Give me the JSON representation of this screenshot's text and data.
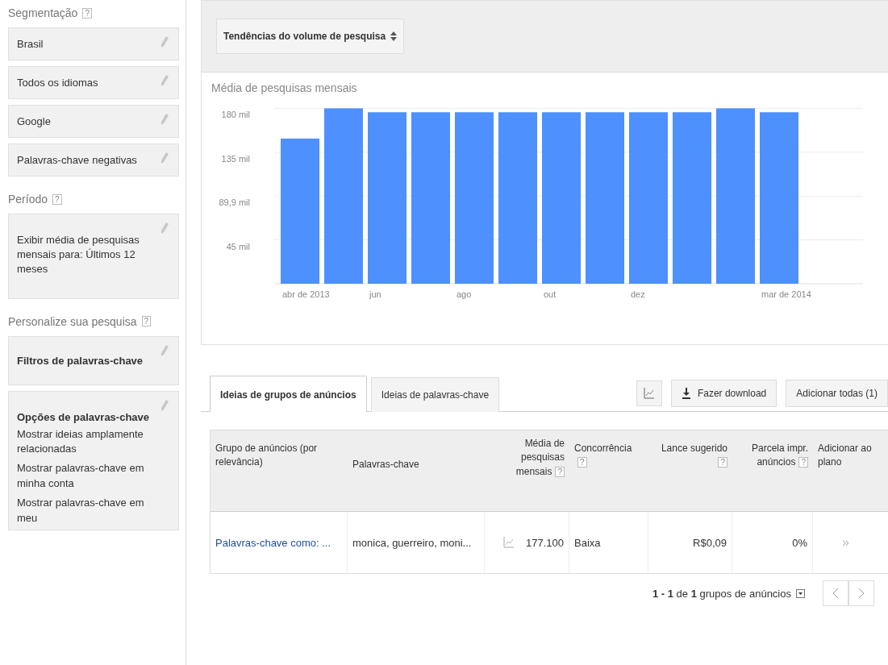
{
  "sidebar": {
    "sections": [
      {
        "title": "Segmentação",
        "help": "?",
        "cards": [
          {
            "kind": "simple",
            "text": "Brasil"
          },
          {
            "kind": "simple",
            "text": "Todos os idiomas"
          },
          {
            "kind": "simple",
            "text": "Google"
          },
          {
            "kind": "simple",
            "text": "Palavras-chave negativas"
          }
        ]
      },
      {
        "title": "Período",
        "help": "?",
        "cards": [
          {
            "kind": "tall",
            "text": "Exibir média de pesquisas mensais para: Últimos 12 meses"
          }
        ]
      },
      {
        "title": "Personalize sua pesquisa",
        "help": "?",
        "cards": [
          {
            "kind": "heading",
            "text": "Filtros de palavras-chave"
          },
          {
            "kind": "options",
            "text": "Opções de palavras-chave",
            "options": [
              "Mostrar ideias amplamente relacionadas",
              "Mostrar palavras-chave em minha conta",
              "Mostrar palavras-chave em meu"
            ]
          }
        ]
      }
    ]
  },
  "trend": {
    "selector": "Tendências do volume de pesquisa",
    "chart_data": {
      "type": "bar",
      "title": "Média de pesquisas mensais",
      "categories": [
        "abr de 2013",
        null,
        "jun",
        null,
        "ago",
        null,
        "out",
        null,
        "dez",
        null,
        null,
        "mar de 2014"
      ],
      "values": [
        149,
        180,
        176,
        176,
        176,
        176,
        176,
        176,
        176,
        176,
        180,
        176
      ],
      "color": "#4d90fe",
      "ylim": [
        0,
        182
      ],
      "grid": true,
      "yticks": [
        {
          "value": 45,
          "label": "45 mil"
        },
        {
          "value": 89.9,
          "label": "89,9 mil"
        },
        {
          "value": 135,
          "label": "135 mil"
        },
        {
          "value": 180,
          "label": "180 mil"
        }
      ]
    }
  },
  "tabs": [
    {
      "label": "Ideias de grupos de anúncios",
      "selected": true
    },
    {
      "label": "Ideias de palavras-chave",
      "selected": false
    }
  ],
  "toolbar": {
    "download": "Fazer download",
    "add_all": "Adicionar todas (1)"
  },
  "table": {
    "columns": [
      {
        "label": "Grupo de anúncios (por relevância)"
      },
      {
        "label": "Palavras-chave"
      },
      {
        "label": "Média de pesquisas mensais",
        "help": "?"
      },
      {
        "label": "Concorrência",
        "help": "?"
      },
      {
        "label": "Lance sugerido",
        "help": "?"
      },
      {
        "label": "Parcela impr. anúncios",
        "help": "?"
      },
      {
        "label": "Adicionar ao plano"
      }
    ],
    "rows": [
      {
        "group": "Palavras-chave como: ...",
        "keywords": "monica, guerreiro, moni...",
        "searches": "177.100",
        "competition": "Baixa",
        "bid": "R$0,09",
        "share": "0%",
        "add": "»"
      }
    ]
  },
  "pagination": "**1 - 1** de **1** grupos de anúncios"
}
